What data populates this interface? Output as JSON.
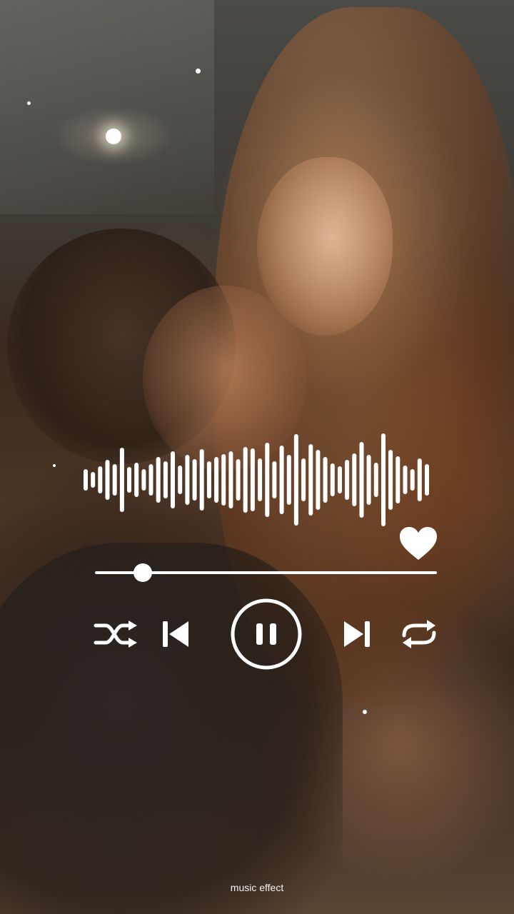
{
  "caption": "music effect",
  "player": {
    "progress": 0.14,
    "liked": true,
    "state": "playing",
    "controls": [
      "shuffle-icon",
      "previous-icon",
      "pause-icon",
      "next-icon",
      "repeat-icon"
    ]
  },
  "colors": {
    "foreground": "#ffffff",
    "background": "#3a2a1e"
  }
}
